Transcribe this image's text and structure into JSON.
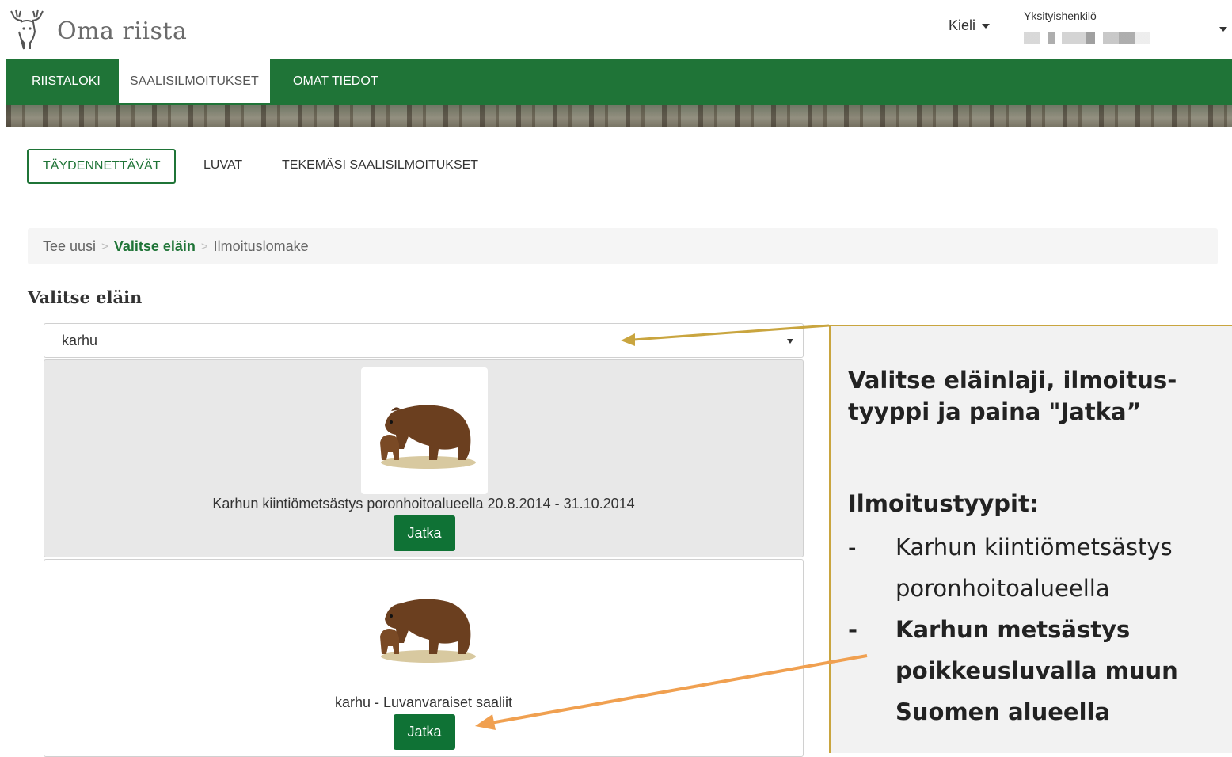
{
  "header": {
    "brand": "Oma riista",
    "language_label": "Kieli",
    "user_type": "Yksityishenkilö",
    "logo_icon": "moose-head-icon"
  },
  "nav": {
    "items": [
      {
        "label": "RIISTALOKI",
        "active": false
      },
      {
        "label": "SAALISILMOITUKSET",
        "active": true
      },
      {
        "label": "OMAT TIEDOT",
        "active": false
      }
    ]
  },
  "subtabs": [
    {
      "label": "TÄYDENNETTÄVÄT",
      "active": true
    },
    {
      "label": "LUVAT",
      "active": false
    },
    {
      "label": "TEKEMÄSI SAALISILMOITUKSET",
      "active": false
    }
  ],
  "breadcrumb": {
    "step1": "Tee uusi",
    "step2": "Valitse eläin",
    "step3": "Ilmoituslomake",
    "separator": ">"
  },
  "section_title": "Valitse eläin",
  "species_select": {
    "value": "karhu"
  },
  "cards": [
    {
      "title": "Karhun kiintiömetsästys poronhoitoalueella 20.8.2014 - 31.10.2014",
      "button": "Jatka",
      "image_icon": "brown-bear-icon"
    },
    {
      "title": "karhu - Luvanvaraiset saaliit",
      "button": "Jatka",
      "image_icon": "brown-bear-icon"
    }
  ],
  "callout": {
    "heading": "Valitse eläinlaji, ilmoitus-tyyppi ja paina \"Jatka”",
    "subheading": "Ilmoitustyypit:",
    "items": [
      {
        "dash": "-",
        "text": "Karhun kiintiömetsästys poronhoitoalueella"
      },
      {
        "dash": "-",
        "text": "Karhun metsästys poikkeusluvalla muun Suomen alueella"
      }
    ]
  },
  "colors": {
    "brand_green": "#1f7437",
    "button_green": "#0f7235",
    "callout_border": "#c9a53f",
    "arrow_orange": "#f0a050"
  }
}
